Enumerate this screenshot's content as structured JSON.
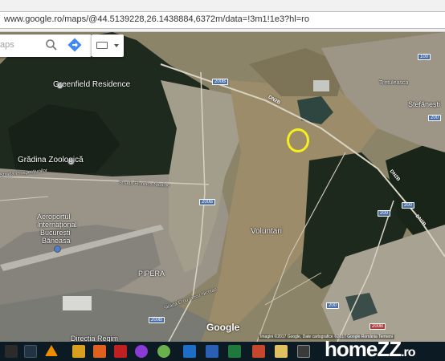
{
  "browser": {
    "url": "www.google.ro/maps/@44.5139228,26.1438884,6372m/data=!3m1!1e3?hl=ro"
  },
  "search": {
    "placeholder": "aps"
  },
  "map": {
    "labels": {
      "greenfield": "Greenfield Residence",
      "zoo": "Grădina Zoologică",
      "airport_line1": "Aeroportul",
      "airport_line2": "Internațional",
      "airport_line3": "București",
      "airport_line4": "Băneasa",
      "voluntari": "Voluntari",
      "pipera": "PIPERA",
      "stefanesti": "Ștefănești",
      "tretuleasca": "Tretuleasca",
      "floricica": "Strada Floricica Nicolae",
      "prospectiuni": "Strada Prospecțiunilor",
      "erou": "Strada Erou Iancu Nicolae",
      "directia": "Direcția Regim",
      "dnp": "DN2B",
      "dn2": "DN2B",
      "dn2b2": "DN2B"
    },
    "shields": {
      "s1": "200B",
      "s2": "200B",
      "s3": "200B",
      "s4": "100",
      "s5": "200",
      "s6": "200",
      "s7": "200",
      "s8": "200",
      "s9": "200B"
    },
    "google_logo": "Google",
    "copyright": "Imagini ©2017 Google, Date cartografice ©2017 Google   România   Termeni"
  },
  "taskbar": {
    "brand_main": "homeZZ",
    "brand_suffix": ".ro"
  },
  "colors": {
    "marker": "#f5ef1d",
    "taskbar": "#0c1a24"
  }
}
